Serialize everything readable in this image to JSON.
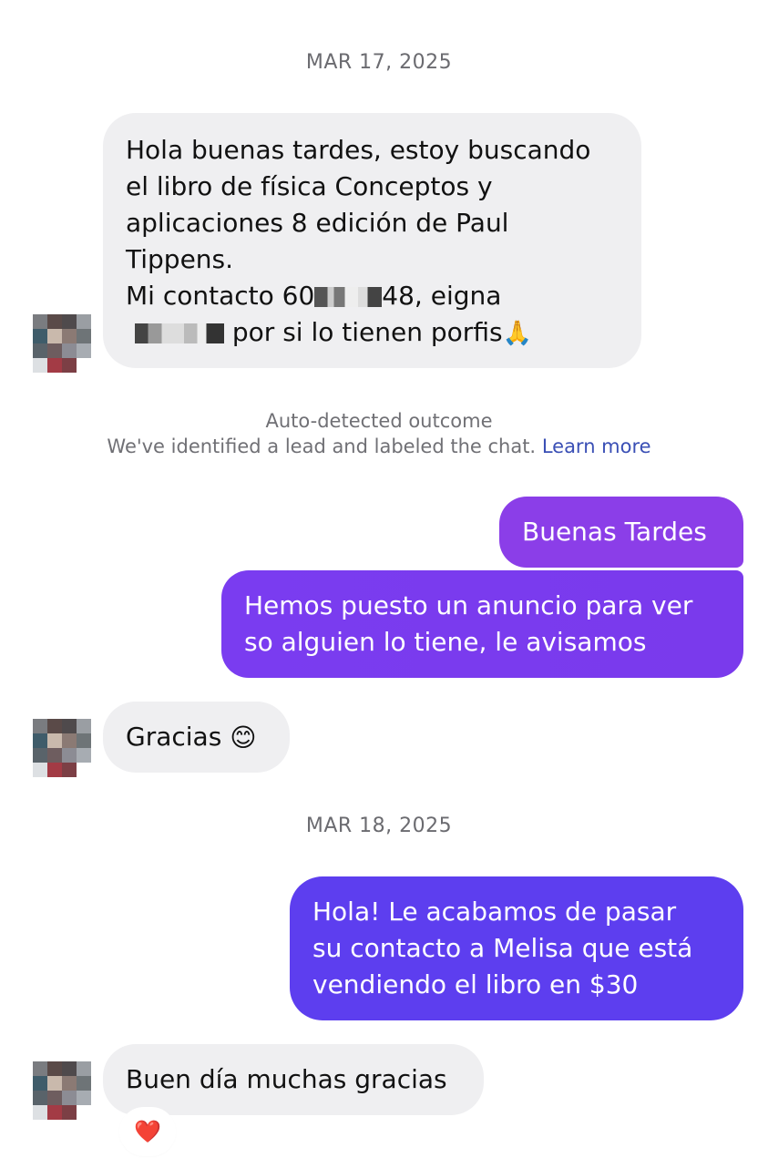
{
  "dates": {
    "first": "MAR 17, 2025",
    "second": "MAR 18, 2025"
  },
  "messages": {
    "m1": {
      "lines": [
        "Hola buenas tardes, estoy buscando",
        "el libro de física Conceptos y",
        "aplicaciones 8 edición de Paul",
        "Tippens."
      ],
      "contact_prefix": "Mi contacto 60",
      "contact_mid": "48, eigna",
      "contact_suffix": " por si lo tienen porfis",
      "emoji": "🙏"
    },
    "m2": {
      "text": "Buenas Tardes"
    },
    "m3": {
      "lines": [
        "Hemos puesto un anuncio para ver",
        "so alguien lo tiene, le avisamos"
      ]
    },
    "m4": {
      "text": "Gracias",
      "emoji": "😊"
    },
    "m5": {
      "lines": [
        "Hola! Le acabamos de pasar",
        "su contacto a Melisa que está",
        "vendiendo el libro en $30"
      ]
    },
    "m6": {
      "text": "Buen día muchas gracias",
      "reaction": "❤️"
    }
  },
  "notice": {
    "title": "Auto-detected outcome",
    "body": "We've identified a lead and labeled the chat.",
    "link": "Learn more"
  },
  "colors": {
    "incoming_bg": "#efeff1",
    "outgoing_gradient_start": "#8b3ee8",
    "outgoing_gradient_end": "#5b3df0",
    "link": "#3a4fb5"
  }
}
